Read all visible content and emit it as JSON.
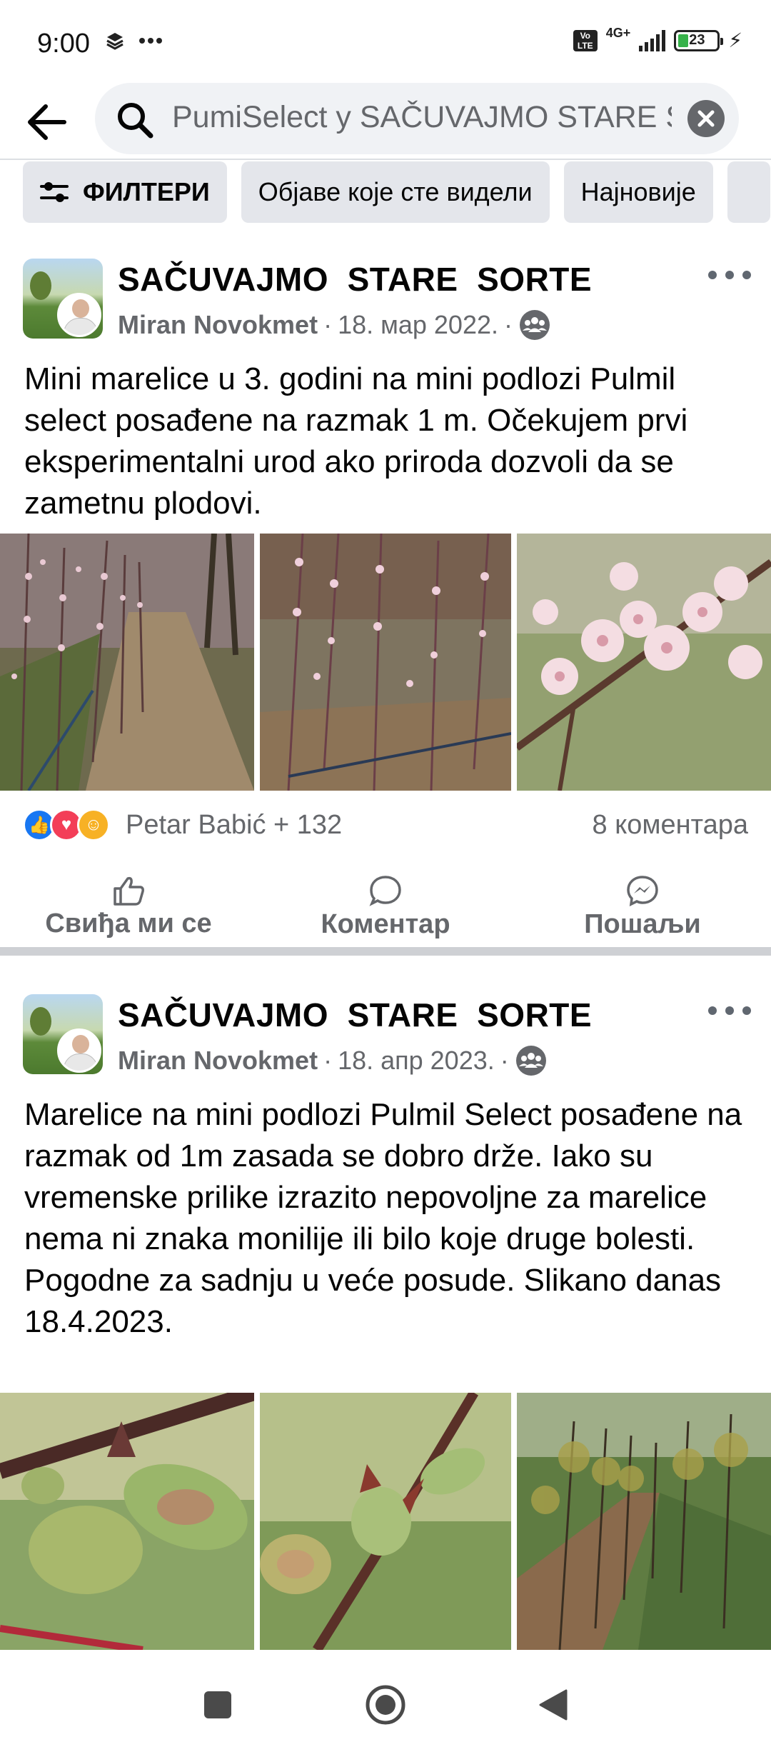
{
  "status_bar": {
    "time": "9:00",
    "network": "4G+",
    "battery": "23"
  },
  "search": {
    "query": "PumiSelect у SAČUVAJMO  STARE  SORTE"
  },
  "filters": [
    {
      "label": "ФИЛТЕРИ",
      "icon": "sliders-icon"
    },
    {
      "label": "Објаве које сте видели"
    },
    {
      "label": "Најновије"
    }
  ],
  "posts": [
    {
      "group": "SAČUVAJMO  STARE  SORTE",
      "author": "Miran Novokmet",
      "date": "18. мар 2022.",
      "text": "Mini marelice u 3. godini na mini podlozi Pulmil select posađene na razmak 1 m. Očekujem prvi eksperimentalni urod ako priroda dozvoli da se zametnu plodovi.",
      "reactions_text": "Petar Babić + 132",
      "comments": "8 коментара",
      "photos": [
        "orchard-blossom-row-photo",
        "blossoming-branches-photo",
        "apricot-flowers-closeup-photo"
      ]
    },
    {
      "group": "SAČUVAJMO  STARE  SORTE",
      "author": "Miran Novokmet",
      "date": "18. апр 2023.",
      "text": "Marelice na mini podlozi Pulmil Select posađene na razmak od 1m zasada se dobro drže. Iako su vremenske prilike izrazito nepovoljne za marelice nema ni znaka monilije ili bilo koje druge bolesti.  Pogodne za sadnju u veće posude. Slikano danas 18.4.2023.",
      "photos": [
        "young-apricots-closeup-photo",
        "apricot-fruitlet-photo",
        "orchard-rows-photo"
      ]
    }
  ],
  "actions": {
    "like": "Свиђа ми се",
    "comment": "Коментар",
    "send": "Пошаљи"
  }
}
